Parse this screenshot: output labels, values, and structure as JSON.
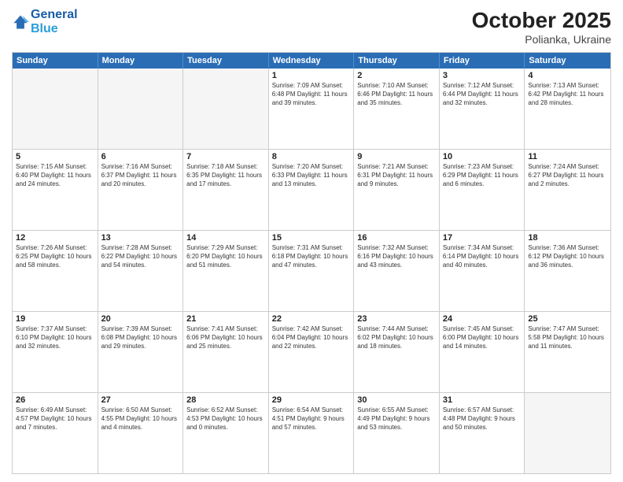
{
  "header": {
    "logo_line1": "General",
    "logo_line2": "Blue",
    "month_title": "October 2025",
    "location": "Polianka, Ukraine"
  },
  "calendar": {
    "days_of_week": [
      "Sunday",
      "Monday",
      "Tuesday",
      "Wednesday",
      "Thursday",
      "Friday",
      "Saturday"
    ],
    "rows": [
      [
        {
          "day": "",
          "info": "",
          "empty": true
        },
        {
          "day": "",
          "info": "",
          "empty": true
        },
        {
          "day": "",
          "info": "",
          "empty": true
        },
        {
          "day": "1",
          "info": "Sunrise: 7:09 AM\nSunset: 6:48 PM\nDaylight: 11 hours\nand 39 minutes.",
          "empty": false
        },
        {
          "day": "2",
          "info": "Sunrise: 7:10 AM\nSunset: 6:46 PM\nDaylight: 11 hours\nand 35 minutes.",
          "empty": false
        },
        {
          "day": "3",
          "info": "Sunrise: 7:12 AM\nSunset: 6:44 PM\nDaylight: 11 hours\nand 32 minutes.",
          "empty": false
        },
        {
          "day": "4",
          "info": "Sunrise: 7:13 AM\nSunset: 6:42 PM\nDaylight: 11 hours\nand 28 minutes.",
          "empty": false
        }
      ],
      [
        {
          "day": "5",
          "info": "Sunrise: 7:15 AM\nSunset: 6:40 PM\nDaylight: 11 hours\nand 24 minutes.",
          "empty": false
        },
        {
          "day": "6",
          "info": "Sunrise: 7:16 AM\nSunset: 6:37 PM\nDaylight: 11 hours\nand 20 minutes.",
          "empty": false
        },
        {
          "day": "7",
          "info": "Sunrise: 7:18 AM\nSunset: 6:35 PM\nDaylight: 11 hours\nand 17 minutes.",
          "empty": false
        },
        {
          "day": "8",
          "info": "Sunrise: 7:20 AM\nSunset: 6:33 PM\nDaylight: 11 hours\nand 13 minutes.",
          "empty": false
        },
        {
          "day": "9",
          "info": "Sunrise: 7:21 AM\nSunset: 6:31 PM\nDaylight: 11 hours\nand 9 minutes.",
          "empty": false
        },
        {
          "day": "10",
          "info": "Sunrise: 7:23 AM\nSunset: 6:29 PM\nDaylight: 11 hours\nand 6 minutes.",
          "empty": false
        },
        {
          "day": "11",
          "info": "Sunrise: 7:24 AM\nSunset: 6:27 PM\nDaylight: 11 hours\nand 2 minutes.",
          "empty": false
        }
      ],
      [
        {
          "day": "12",
          "info": "Sunrise: 7:26 AM\nSunset: 6:25 PM\nDaylight: 10 hours\nand 58 minutes.",
          "empty": false
        },
        {
          "day": "13",
          "info": "Sunrise: 7:28 AM\nSunset: 6:22 PM\nDaylight: 10 hours\nand 54 minutes.",
          "empty": false
        },
        {
          "day": "14",
          "info": "Sunrise: 7:29 AM\nSunset: 6:20 PM\nDaylight: 10 hours\nand 51 minutes.",
          "empty": false
        },
        {
          "day": "15",
          "info": "Sunrise: 7:31 AM\nSunset: 6:18 PM\nDaylight: 10 hours\nand 47 minutes.",
          "empty": false
        },
        {
          "day": "16",
          "info": "Sunrise: 7:32 AM\nSunset: 6:16 PM\nDaylight: 10 hours\nand 43 minutes.",
          "empty": false
        },
        {
          "day": "17",
          "info": "Sunrise: 7:34 AM\nSunset: 6:14 PM\nDaylight: 10 hours\nand 40 minutes.",
          "empty": false
        },
        {
          "day": "18",
          "info": "Sunrise: 7:36 AM\nSunset: 6:12 PM\nDaylight: 10 hours\nand 36 minutes.",
          "empty": false
        }
      ],
      [
        {
          "day": "19",
          "info": "Sunrise: 7:37 AM\nSunset: 6:10 PM\nDaylight: 10 hours\nand 32 minutes.",
          "empty": false
        },
        {
          "day": "20",
          "info": "Sunrise: 7:39 AM\nSunset: 6:08 PM\nDaylight: 10 hours\nand 29 minutes.",
          "empty": false
        },
        {
          "day": "21",
          "info": "Sunrise: 7:41 AM\nSunset: 6:06 PM\nDaylight: 10 hours\nand 25 minutes.",
          "empty": false
        },
        {
          "day": "22",
          "info": "Sunrise: 7:42 AM\nSunset: 6:04 PM\nDaylight: 10 hours\nand 22 minutes.",
          "empty": false
        },
        {
          "day": "23",
          "info": "Sunrise: 7:44 AM\nSunset: 6:02 PM\nDaylight: 10 hours\nand 18 minutes.",
          "empty": false
        },
        {
          "day": "24",
          "info": "Sunrise: 7:45 AM\nSunset: 6:00 PM\nDaylight: 10 hours\nand 14 minutes.",
          "empty": false
        },
        {
          "day": "25",
          "info": "Sunrise: 7:47 AM\nSunset: 5:58 PM\nDaylight: 10 hours\nand 11 minutes.",
          "empty": false
        }
      ],
      [
        {
          "day": "26",
          "info": "Sunrise: 6:49 AM\nSunset: 4:57 PM\nDaylight: 10 hours\nand 7 minutes.",
          "empty": false
        },
        {
          "day": "27",
          "info": "Sunrise: 6:50 AM\nSunset: 4:55 PM\nDaylight: 10 hours\nand 4 minutes.",
          "empty": false
        },
        {
          "day": "28",
          "info": "Sunrise: 6:52 AM\nSunset: 4:53 PM\nDaylight: 10 hours\nand 0 minutes.",
          "empty": false
        },
        {
          "day": "29",
          "info": "Sunrise: 6:54 AM\nSunset: 4:51 PM\nDaylight: 9 hours\nand 57 minutes.",
          "empty": false
        },
        {
          "day": "30",
          "info": "Sunrise: 6:55 AM\nSunset: 4:49 PM\nDaylight: 9 hours\nand 53 minutes.",
          "empty": false
        },
        {
          "day": "31",
          "info": "Sunrise: 6:57 AM\nSunset: 4:48 PM\nDaylight: 9 hours\nand 50 minutes.",
          "empty": false
        },
        {
          "day": "",
          "info": "",
          "empty": true
        }
      ]
    ]
  }
}
